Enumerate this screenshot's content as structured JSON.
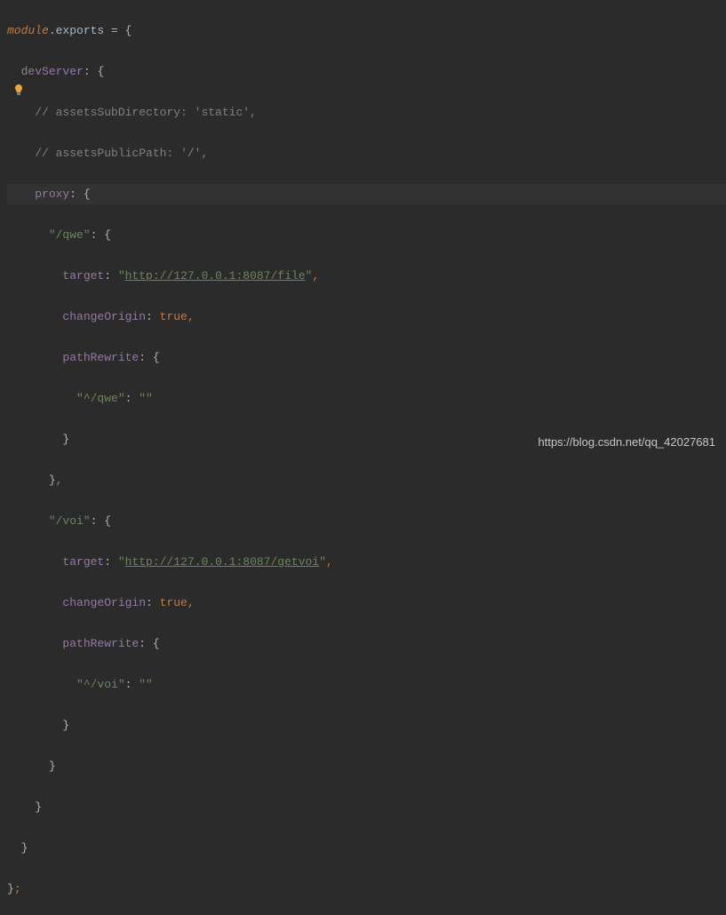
{
  "watermark": "https://blog.csdn.net/qq_42027681",
  "lines": {
    "l1_module": "module",
    "l1_exports": ".exports ",
    "l1_eq": "= ",
    "l1_brace": "{",
    "l2_prop": "devServer",
    "l2_colon": ": ",
    "l2_brace": "{",
    "l3_comment": "// assetsSubDirectory: 'static',",
    "l4_comment": "// assetsPublicPath: '/',",
    "l5_prop": "proxy",
    "l5_colon": ": ",
    "l5_brace": "{",
    "l6_key": "\"/qwe\"",
    "l6_colon": ": ",
    "l6_brace": "{",
    "l7_prop": "target",
    "l7_colon": ": ",
    "l7_q1": "\"",
    "l7_link": "http://127.0.0.1:8087/file",
    "l7_q2": "\"",
    "l7_comma": ",",
    "l8_prop": "changeOrigin",
    "l8_colon": ": ",
    "l8_val": "true",
    "l8_comma": ",",
    "l9_prop": "pathRewrite",
    "l9_colon": ": ",
    "l9_brace": "{",
    "l10_key": "\"^/qwe\"",
    "l10_colon": ": ",
    "l10_val": "\"\"",
    "l11_brace": "}",
    "l12_brace": "}",
    "l12_comma": ",",
    "l13_key": "\"/voi\"",
    "l13_colon": ": ",
    "l13_brace": "{",
    "l14_prop": "target",
    "l14_colon": ": ",
    "l14_q1": "\"",
    "l14_link": "http://127.0.0.1:8087/getvoi",
    "l14_q2": "\"",
    "l14_comma": ",",
    "l15_prop": "changeOrigin",
    "l15_colon": ": ",
    "l15_val": "true",
    "l15_comma": ",",
    "l16_prop": "pathRewrite",
    "l16_colon": ": ",
    "l16_brace": "{",
    "l17_key": "\"^/voi\"",
    "l17_colon": ": ",
    "l17_val": "\"\"",
    "l18_brace": "}",
    "l19_brace": "}",
    "l20_brace": "}",
    "l21_brace": "}",
    "l22_brace": "}",
    "l22_semi": ";"
  }
}
